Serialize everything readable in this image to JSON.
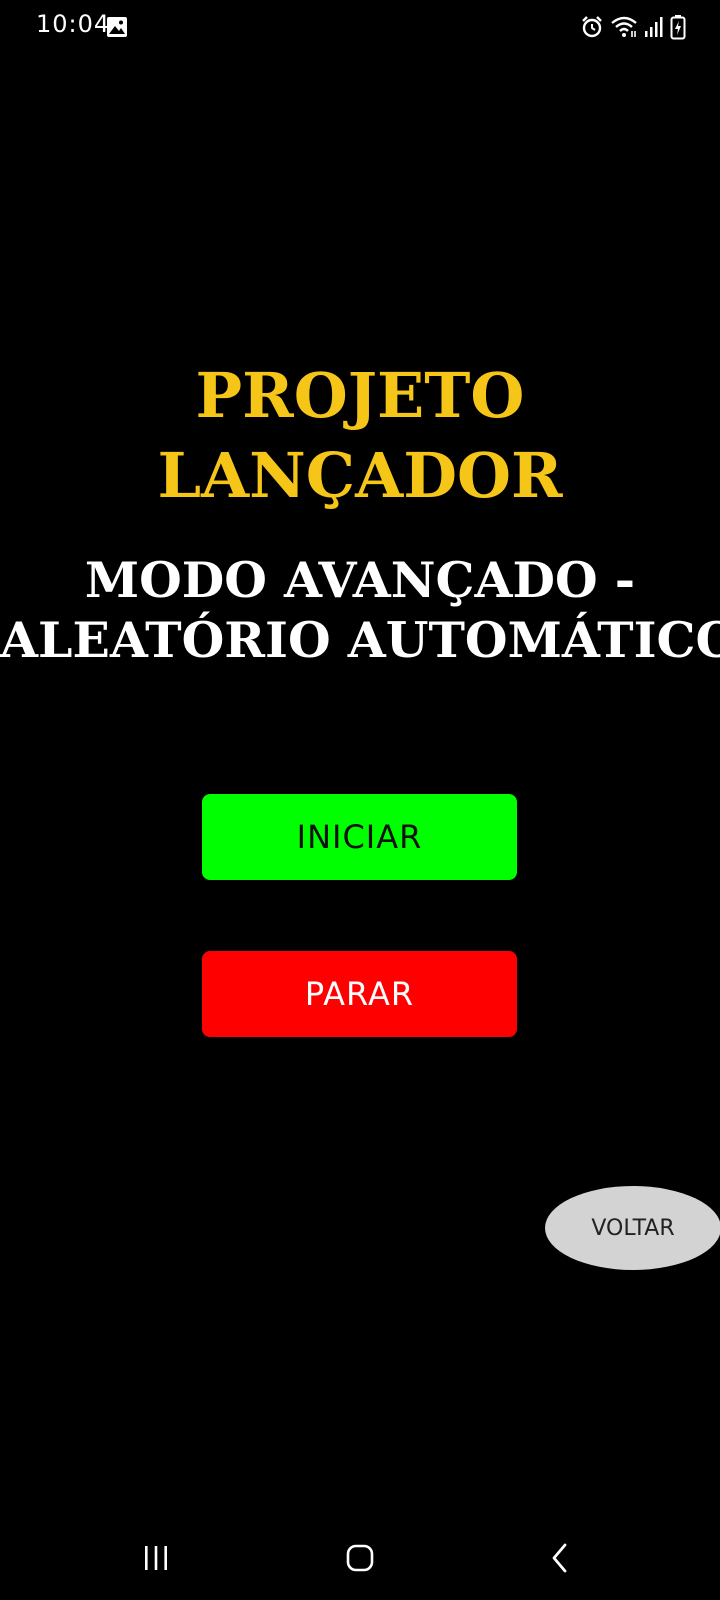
{
  "status_bar": {
    "time": "10:04",
    "icons": [
      "gallery-icon",
      "alarm-icon",
      "wifi-icon",
      "signal-icon",
      "battery-charging-icon"
    ]
  },
  "header": {
    "title_line1": "PROJETO",
    "title_line2": "LANÇADOR",
    "subtitle_line1": "MODO AVANÇADO -",
    "subtitle_line2": "ALEATÓRIO AUTOMÁTICO"
  },
  "buttons": {
    "start_label": "INICIAR",
    "stop_label": "PARAR",
    "back_label": "VOLTAR"
  },
  "nav_bar": {
    "icons": [
      "recent-apps-icon",
      "home-icon",
      "back-icon"
    ]
  },
  "colors": {
    "background": "#000000",
    "title": "#f5c518",
    "subtitle": "#ffffff",
    "start_button": "#00ff00",
    "stop_button": "#ff0000",
    "back_button": "#d3d3d3"
  }
}
